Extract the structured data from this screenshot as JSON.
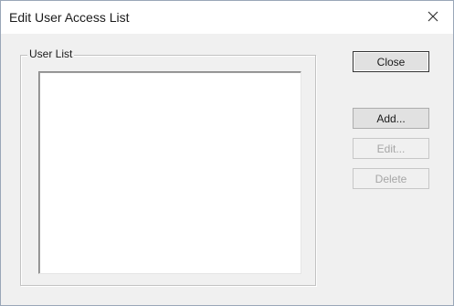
{
  "window": {
    "title": "Edit User Access List"
  },
  "group": {
    "label": "User List",
    "items": []
  },
  "buttons": {
    "close_label": "Close",
    "add_label": "Add...",
    "edit_label": "Edit...",
    "delete_label": "Delete"
  },
  "icons": {
    "window_close": "close-icon"
  },
  "colors": {
    "dialog_bg": "#f0f0f0",
    "disabled_text": "#a6a6a6"
  }
}
